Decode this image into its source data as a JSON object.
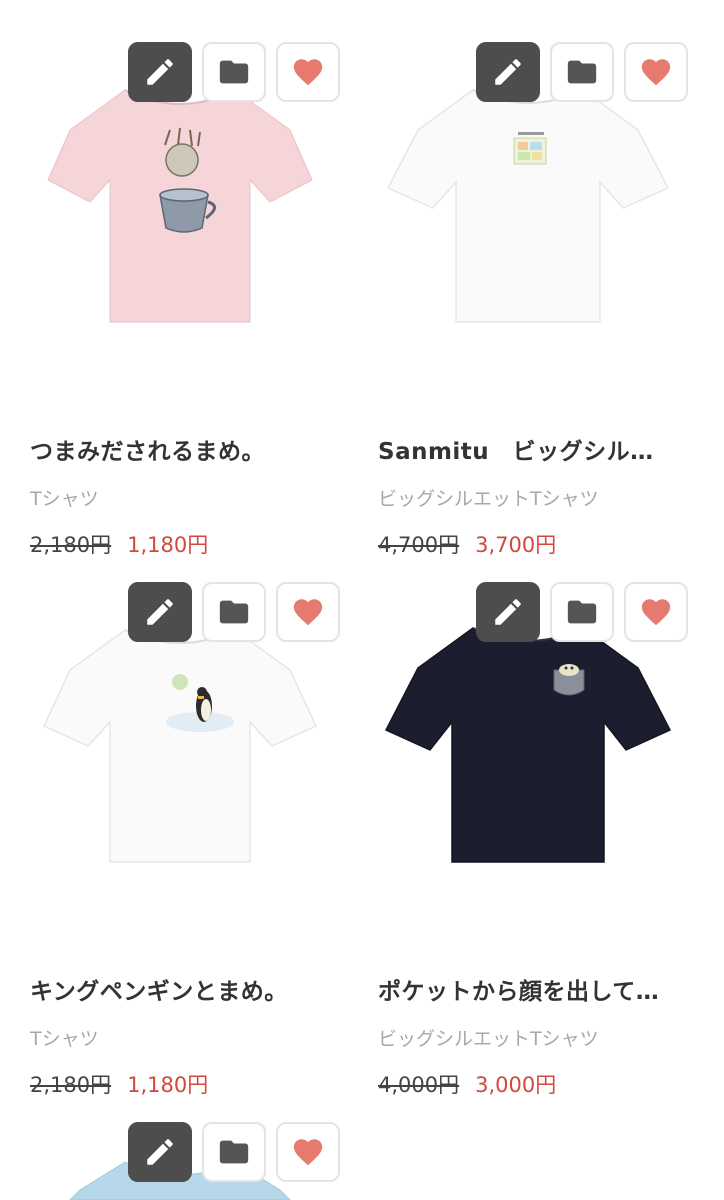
{
  "products": [
    {
      "title": "つまみだされるまめ。",
      "type": "Tシャツ",
      "old_price": "2,180円",
      "new_price": "1,180円",
      "shirt_color": "#f5d5d8"
    },
    {
      "title": "Sanmitu　ビッグシル…",
      "type": "ビッグシルエットTシャツ",
      "old_price": "4,700円",
      "new_price": "3,700円",
      "shirt_color": "#fafafa"
    },
    {
      "title": "キングペンギンとまめ。",
      "type": "Tシャツ",
      "old_price": "2,180円",
      "new_price": "1,180円",
      "shirt_color": "#fafafa"
    },
    {
      "title": "ポケットから顔を出して…",
      "type": "ビッグシルエットTシャツ",
      "old_price": "4,000円",
      "new_price": "3,000円",
      "shirt_color": "#1c1e30"
    },
    {
      "shirt_color": "#b6d8ea"
    }
  ],
  "icons": {
    "edit": "pencil-icon",
    "folder": "folder-icon",
    "favorite": "heart-icon"
  },
  "colors": {
    "sale_price": "#d2483c",
    "edit_button_bg": "#4d4d4d",
    "heart": "#e77a6f"
  }
}
